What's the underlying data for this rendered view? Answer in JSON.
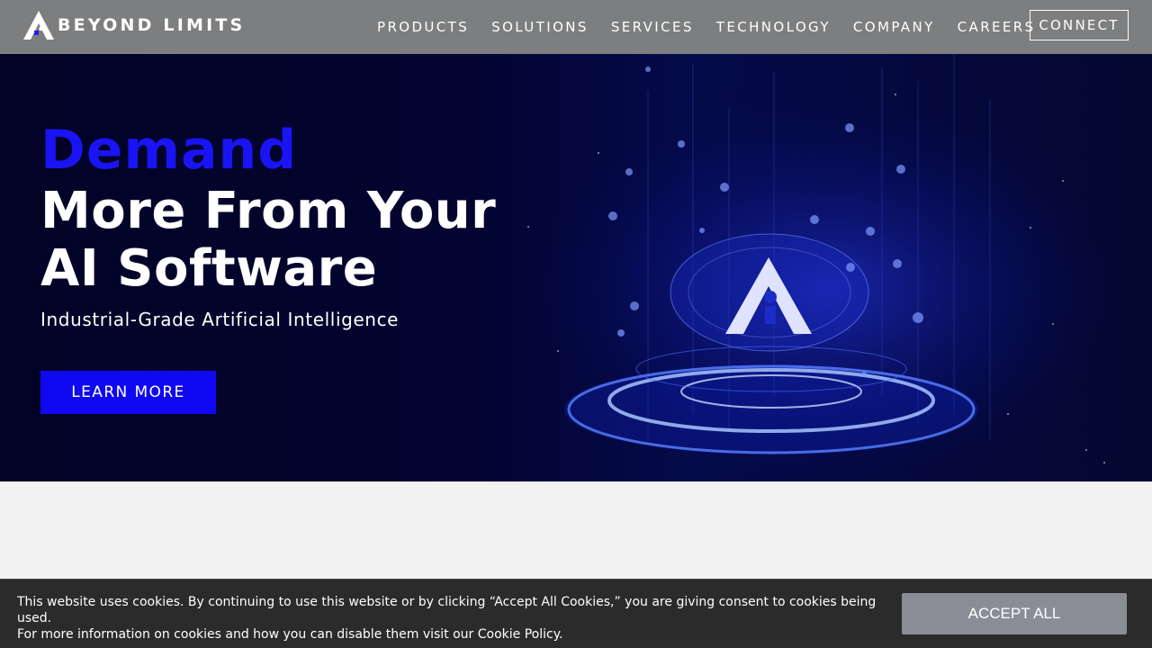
{
  "header": {
    "logo_text": "BEYOND LIMITS",
    "nav": [
      "PRODUCTS",
      "SOLUTIONS",
      "SERVICES",
      "TECHNOLOGY",
      "COMPANY",
      "CAREERS"
    ],
    "connect_label": "CONNECT",
    "logo_icon": "beyond-limits-a-icon"
  },
  "hero": {
    "headline_accent": "Demand",
    "headline_line1": "More From Your",
    "headline_line2": "AI Software",
    "subtitle": "Industrial-Grade Artificial Intelligence",
    "cta_label": "LEARN MORE",
    "illustration": "ai-brain-hologram"
  },
  "cookie_banner": {
    "line1": "This website uses cookies. By continuing to use this website or by clicking “Accept All Cookies,” you are giving consent to cookies being used.",
    "line2": "For more information on cookies and how you can disable them visit our Cookie Policy.",
    "accept_label": "ACCEPT ALL"
  },
  "colors": {
    "header_bg": "#7d7e7f",
    "hero_bg": "#030430",
    "accent_blue": "#1a14f5",
    "cta_bg": "#0f08f0",
    "cookie_bg": "#2b2b2b",
    "accept_bg": "#8a8d96",
    "page_bg": "#f2f2f2"
  }
}
